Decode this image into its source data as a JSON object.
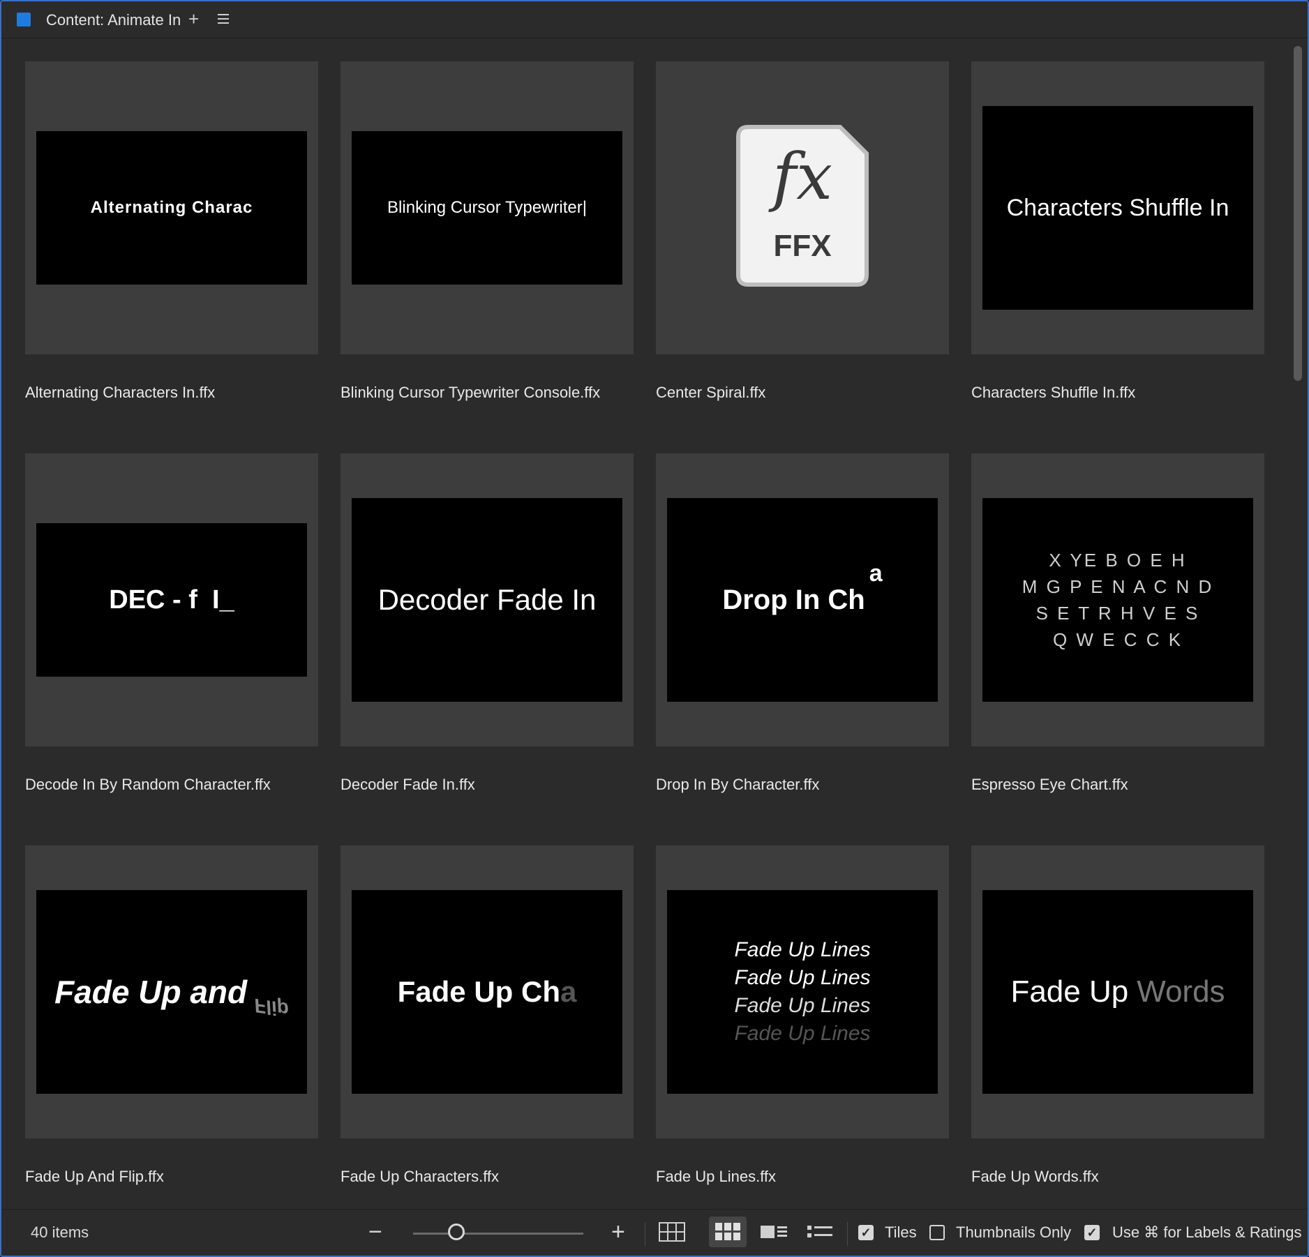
{
  "header": {
    "title": "Content: Animate In",
    "add_icon": "plus-icon",
    "menu_icon": "hamburger-menu-icon"
  },
  "items": [
    {
      "label": "Alternating Characters In.ffx",
      "preview": "Alternating Charac"
    },
    {
      "label": "Blinking Cursor Typewriter Console.ffx",
      "preview": "Blinking Cursor Typewriter|"
    },
    {
      "label": "Center Spiral.ffx",
      "preview_fx": "fx",
      "preview_type": "FFX"
    },
    {
      "label": "Characters Shuffle In.ffx",
      "preview": "Characters Shuffle In"
    },
    {
      "label": "Decode In By Random Character.ffx",
      "preview": "DEC - f  I_"
    },
    {
      "label": "Decoder Fade In.ffx",
      "preview": "Decoder Fade In"
    },
    {
      "label": "Drop In By Character.ffx",
      "preview": "Drop In Ch",
      "preview_extra": "a"
    },
    {
      "label": "Espresso Eye Chart.ffx",
      "preview_lines": [
        "X YE  B O E   H",
        "M G P E   N A  C N  D",
        "S  E  T R H   V E S",
        "Q  W E   C  C  K"
      ]
    },
    {
      "label": "Fade Up And Flip.ffx",
      "preview": "Fade Up and",
      "preview_extra": "Flip"
    },
    {
      "label": "Fade Up Characters.ffx",
      "preview": "Fade Up Ch",
      "preview_extra": "a"
    },
    {
      "label": "Fade Up Lines.ffx",
      "preview_lines": [
        "Fade Up Lines",
        "Fade Up Lines",
        "Fade Up Lines",
        "Fade Up Lines"
      ]
    },
    {
      "label": "Fade Up Words.ffx",
      "preview": "Fade Up",
      "preview_extra": "Words"
    }
  ],
  "footer": {
    "count": "40 items",
    "zoom_out_icon": "minus-icon",
    "zoom_in_icon": "plus-icon",
    "zoom_level": 0.25,
    "view_buttons": [
      "grid-view-icon",
      "thumbnail-view-icon",
      "filmstrip-view-icon",
      "list-view-icon"
    ],
    "active_view": "thumbnail-view-icon",
    "tiles": {
      "label": "Tiles",
      "checked": true
    },
    "thumbnails_only": {
      "label": "Thumbnails Only",
      "checked": false
    },
    "use_cmd": {
      "label": "Use ⌘ for Labels & Ratings",
      "checked": true
    }
  }
}
